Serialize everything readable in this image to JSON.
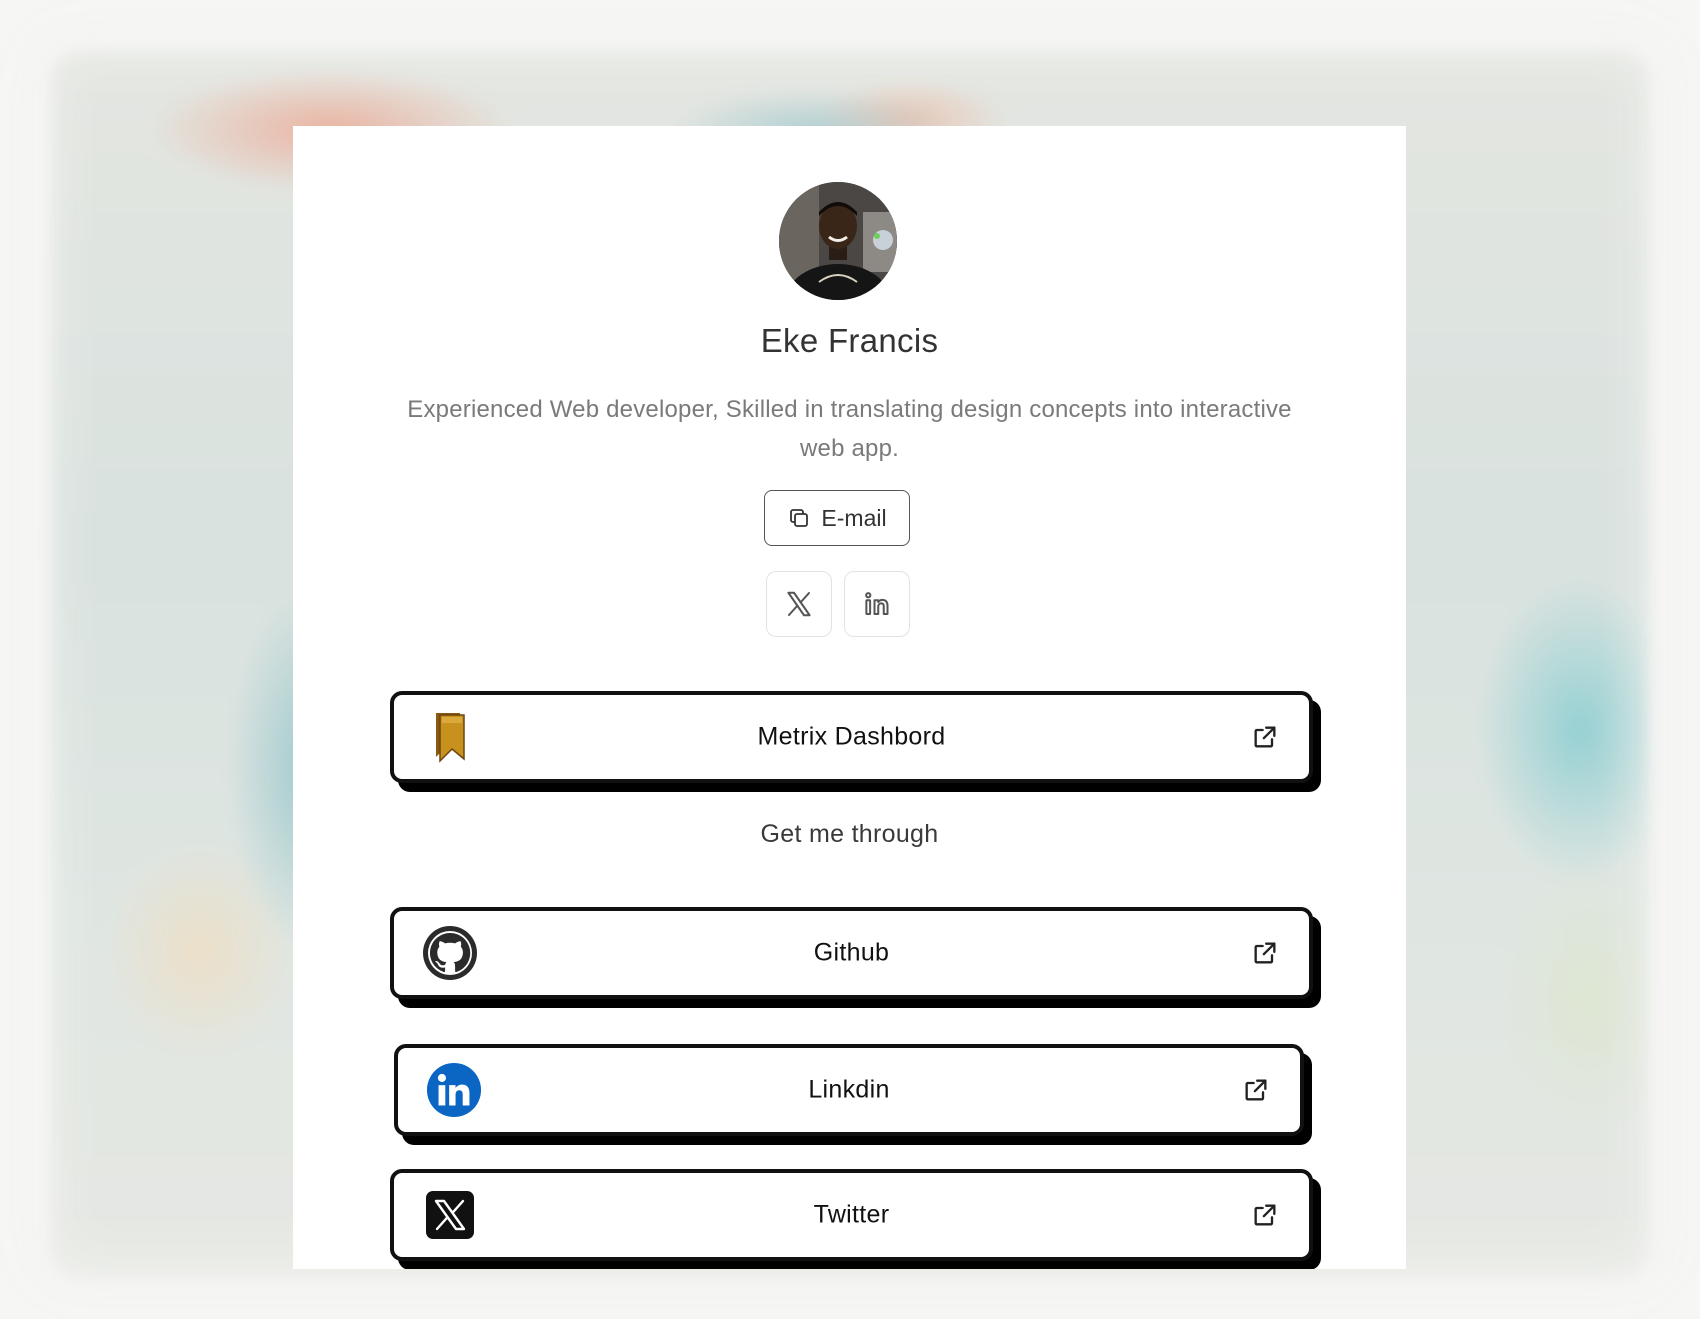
{
  "profile": {
    "name": "Eke Francis",
    "bio": "Experienced Web developer, Skilled in translating design concepts into interactive web app."
  },
  "email_button": {
    "label": "E-mail",
    "icon": "copy-icon"
  },
  "social_buttons": [
    {
      "name": "x",
      "icon": "x-icon"
    },
    {
      "name": "linkedin",
      "icon": "linkedin-icon"
    }
  ],
  "featured_link": {
    "label": "Metrix Dashbord",
    "icon": "bookmark-icon"
  },
  "section": {
    "title": "Get me through"
  },
  "links": [
    {
      "label": "Github",
      "icon": "github-icon"
    },
    {
      "label": "Linkdin",
      "icon": "linkedin-icon",
      "color": "#0a66c2"
    },
    {
      "label": "Twitter",
      "icon": "x-icon"
    }
  ],
  "colors": {
    "card_border": "#111111",
    "linkedin_brand": "#0a66c2",
    "bookmark": "#b8860b"
  }
}
